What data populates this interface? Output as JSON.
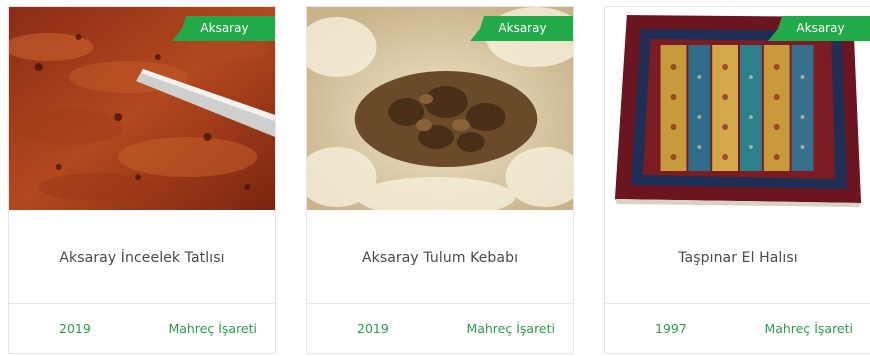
{
  "cards": [
    {
      "badge": "Aksaray",
      "title": "Aksaray İnceelek Tatlısı",
      "year": "2019",
      "category": "Mahreç İşareti"
    },
    {
      "badge": "Aksaray",
      "title": "Aksaray Tulum Kebabı",
      "year": "2019",
      "category": "Mahreç İşareti"
    },
    {
      "badge": "Aksaray",
      "title": "Taşpınar El Halısı",
      "year": "1997",
      "category": "Mahreç İşareti"
    }
  ],
  "colors": {
    "badge": "#22a94a",
    "link": "#2c9c4a",
    "title": "#4a4a4a",
    "border": "#e6e6e6"
  }
}
